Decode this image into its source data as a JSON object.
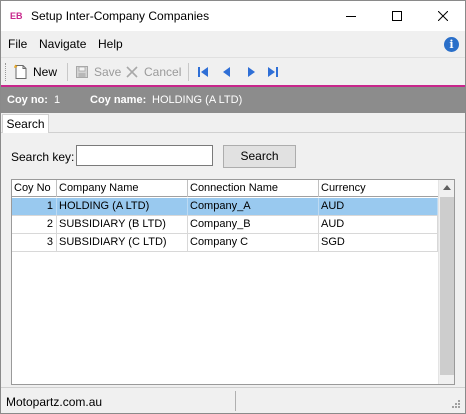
{
  "window": {
    "badge": "EB",
    "title": "Setup Inter-Company Companies"
  },
  "menu": {
    "file": "File",
    "navigate": "Navigate",
    "help": "Help"
  },
  "toolbar": {
    "new_label": "New",
    "save_label": "Save",
    "cancel_label": "Cancel"
  },
  "header": {
    "coy_no_label": "Coy no:",
    "coy_no_value": "1",
    "coy_name_label": "Coy name:",
    "coy_name_value": "HOLDING (A LTD)"
  },
  "tabs": [
    {
      "label": "Search",
      "active": true
    }
  ],
  "search": {
    "label": "Search key:",
    "value": "",
    "button_label": "Search"
  },
  "grid": {
    "columns": [
      "Coy No",
      "Company Name",
      "Connection Name",
      "Currency"
    ],
    "rows": [
      {
        "coy_no": "1",
        "company_name": "HOLDING (A LTD)",
        "connection_name": "Company_A",
        "currency": "AUD",
        "selected": true
      },
      {
        "coy_no": "2",
        "company_name": "SUBSIDIARY (B LTD)",
        "connection_name": "Company_B",
        "currency": "AUD",
        "selected": false
      },
      {
        "coy_no": "3",
        "company_name": "SUBSIDIARY (C LTD)",
        "connection_name": "Company C",
        "currency": "SGD",
        "selected": false
      }
    ]
  },
  "status": {
    "left_text": "Motopartz.com.au"
  },
  "colors": {
    "accent": "#c8268c",
    "header_strip": "#8c8c8c",
    "selection": "#99c9ef"
  }
}
